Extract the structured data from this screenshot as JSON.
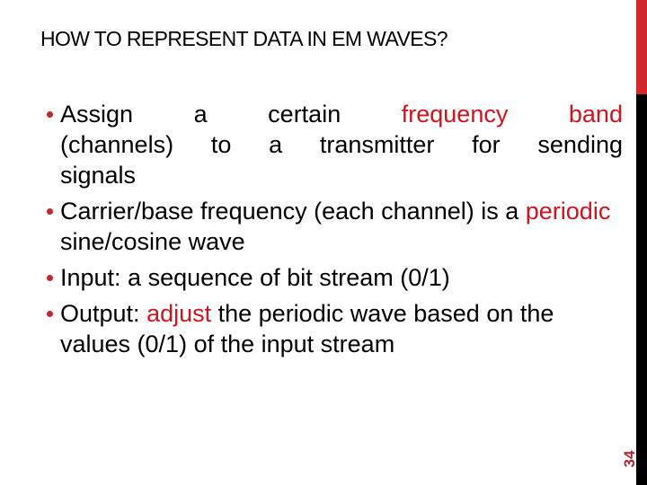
{
  "slide": {
    "title": "HOW TO REPRESENT DATA IN EM WAVES?",
    "page_number": "34",
    "accent_color": "#d0282e",
    "bullets": [
      {
        "line1_words": [
          "Assign",
          "a",
          "certain"
        ],
        "line1_red_words": [
          "frequency",
          "band"
        ],
        "rest": "(channels) to a transmitter for sending signals"
      },
      {
        "text_before": "Carrier/base frequency (each channel) is a ",
        "red": "periodic",
        "text_after": " sine/cosine wave"
      },
      {
        "text": "Input: a sequence of bit stream (0/1)"
      },
      {
        "text_before": "Output: ",
        "red": "adjust",
        "text_after": " the periodic wave based on the values (0/1) of the input stream"
      }
    ]
  }
}
